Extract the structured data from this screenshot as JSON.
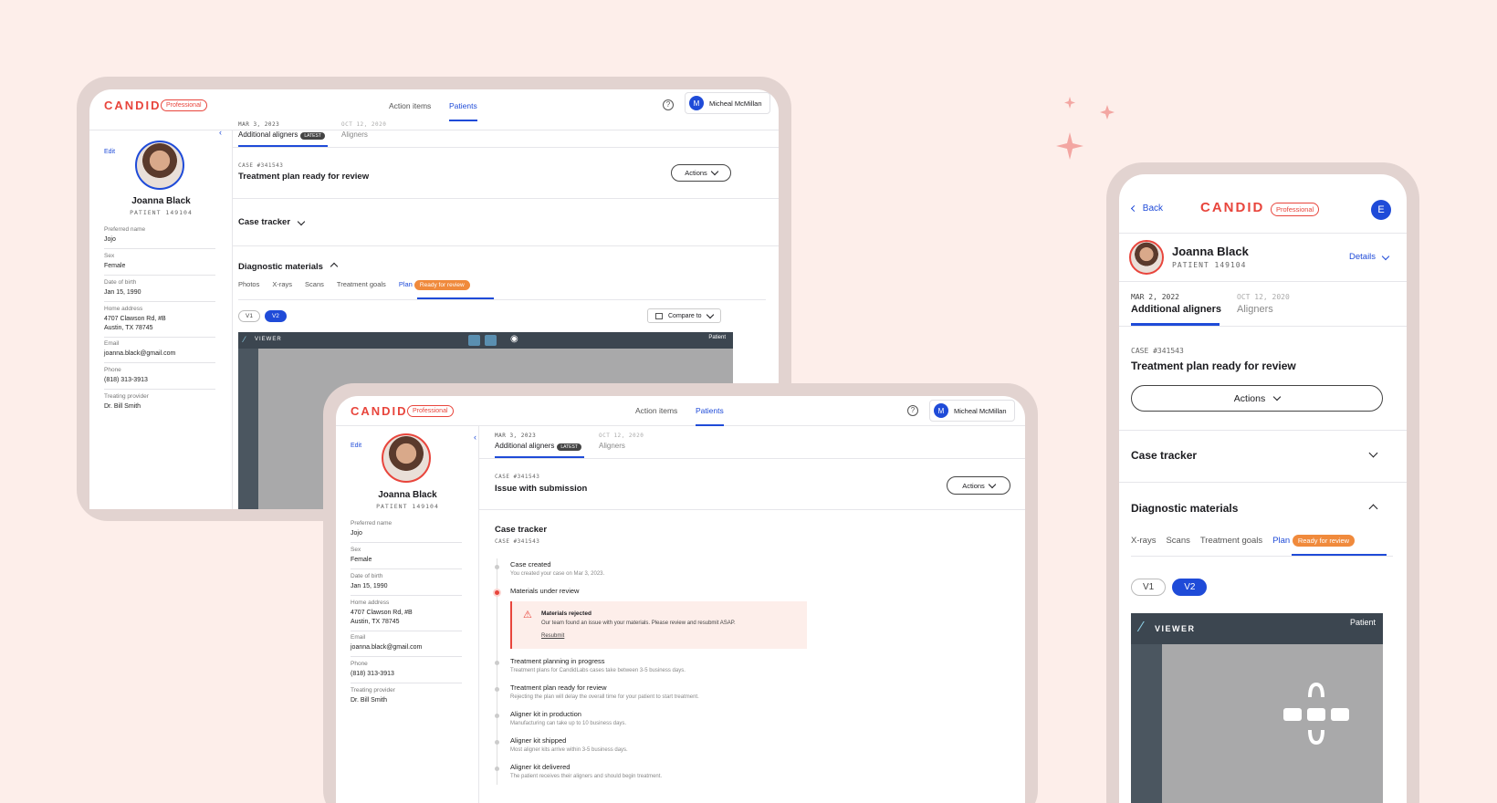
{
  "brand": {
    "logo": "CANDID",
    "badge": "Professional",
    "accent": "#e8453c",
    "primary": "#1f4bd8",
    "status_orange": "#f08a3c"
  },
  "nav": {
    "action_items": "Action items",
    "patients": "Patients"
  },
  "user": {
    "initial": "M",
    "name": "Micheal McMillan"
  },
  "patient": {
    "edit": "Edit",
    "name": "Joanna Black",
    "id": "PATIENT 149104",
    "fields": [
      {
        "label": "Preferred name",
        "value": "Jojo"
      },
      {
        "label": "Sex",
        "value": "Female"
      },
      {
        "label": "Date of birth",
        "value": "Jan 15, 1990"
      },
      {
        "label": "Home address",
        "value": "4707 Clawson Rd, #B\nAustin, TX 78745"
      },
      {
        "label": "Email",
        "value": "joanna.black@gmail.com"
      },
      {
        "label": "Phone",
        "value": "(818) 313-3913"
      },
      {
        "label": "Treating provider",
        "value": "Dr. Bill Smith"
      }
    ]
  },
  "case_tabs": [
    {
      "date": "MAR 3, 2023",
      "title": "Additional aligners",
      "badge": "LATEST"
    },
    {
      "date": "OCT 12, 2020",
      "title": "Aligners"
    }
  ],
  "screen1": {
    "case_label": "CASE #341543",
    "case_title": "Treatment plan ready for review",
    "actions": "Actions",
    "case_tracker": "Case tracker",
    "diagnostic": "Diagnostic materials",
    "sub_tabs": [
      "Photos",
      "X-rays",
      "Scans",
      "Treatment goals",
      "Plan"
    ],
    "ready_badge": "Ready for review",
    "versions": [
      "V1",
      "V2"
    ],
    "compare": "Compare to",
    "viewer": "VIEWER",
    "viewer_patient": "Patient"
  },
  "screen2": {
    "case_label": "CASE #341543",
    "case_title": "Issue with submission",
    "actions": "Actions",
    "tracker_title": "Case tracker",
    "tracker_case": "CASE #341543",
    "timeline": [
      {
        "title": "Case created",
        "sub": "You created your case on Mar 3, 2023."
      },
      {
        "title": "Materials under review",
        "sub": ""
      },
      {
        "title": "Treatment planning in progress",
        "sub": "Treatment plans for CandidLabs cases take between 3-5 business days."
      },
      {
        "title": "Treatment plan ready for review",
        "sub": "Rejecting the plan will delay the overall time for your patient to start treatment."
      },
      {
        "title": "Aligner kit in production",
        "sub": "Manufacturing can take up to 10 business days."
      },
      {
        "title": "Aligner kit shipped",
        "sub": "Most aligner kits arrive within 3-5 business days."
      },
      {
        "title": "Aligner kit delivered",
        "sub": "The patient receives their aligners and should begin treatment."
      }
    ],
    "alert_title": "Materials rejected",
    "alert_body": "Our team found an issue with your materials. Please review and resubmit ASAP.",
    "alert_link": "Resubmit"
  },
  "mobile": {
    "back": "Back",
    "avatar": "E",
    "details": "Details",
    "case_tabs": [
      {
        "date": "MAR 2, 2022",
        "title": "Additional aligners"
      },
      {
        "date": "OCT 12, 2020",
        "title": "Aligners"
      }
    ],
    "case_label": "CASE #341543",
    "case_title": "Treatment plan ready for review",
    "actions": "Actions",
    "case_tracker": "Case tracker",
    "diagnostic": "Diagnostic materials",
    "sub_tabs": [
      "X-rays",
      "Scans",
      "Treatment goals",
      "Plan"
    ],
    "ready_badge": "Ready for review",
    "versions": [
      "V1",
      "V2"
    ],
    "viewer": "VIEWER",
    "viewer_patient": "Patient"
  }
}
